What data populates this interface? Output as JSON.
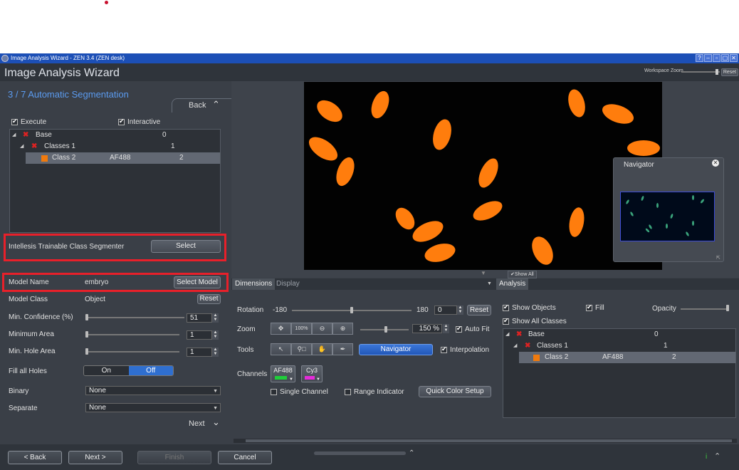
{
  "titlebar": {
    "text": "Image Analysis Wizard - ZEN 3.4 (ZEN desk)",
    "buttons": [
      "?",
      "–",
      "▫",
      "▢",
      "✕"
    ]
  },
  "header": {
    "title": "Image Analysis Wizard",
    "workspace_zoom_label": "Workspace Zoom",
    "reset_label": "Reset"
  },
  "wizard": {
    "step": "3 / 7 Automatic Segmentation",
    "back_label": "Back",
    "next_label": "Next",
    "execute_label": "Execute",
    "interactive_label": "Interactive",
    "tree": [
      {
        "name": "Base",
        "channel": "",
        "value": "0"
      },
      {
        "name": "Classes 1",
        "channel": "",
        "value": "1"
      },
      {
        "name": "Class 2",
        "channel": "AF488",
        "value": "2"
      }
    ],
    "segmenter_label": "Intellesis Trainable Class Segmenter",
    "select_label": "Select",
    "model_name_label": "Model Name",
    "model_name_value": "embryo",
    "select_model_label": "Select Model",
    "model_class_label": "Model Class",
    "model_class_value": "Object",
    "reset_label": "Reset",
    "min_confidence_label": "Min. Confidence (%)",
    "min_confidence_value": "51",
    "minimum_area_label": "Minimum Area",
    "minimum_area_value": "1",
    "min_hole_area_label": "Min. Hole Area",
    "min_hole_area_value": "1",
    "fill_all_holes_label": "Fill all Holes",
    "on_label": "On",
    "off_label": "Off",
    "binary_label": "Binary",
    "binary_value": "None",
    "separate_label": "Separate",
    "separate_value": "None"
  },
  "bottom": {
    "back": "< Back",
    "next": "Next >",
    "finish": "Finish",
    "cancel": "Cancel"
  },
  "navigator": {
    "title": "Navigator",
    "show_all": "Show All"
  },
  "tabs": {
    "dimensions": "Dimensions",
    "display": "Display",
    "analysis": "Analysis"
  },
  "dimensions": {
    "rotation_label": "Rotation",
    "rotation_min": "-180",
    "rotation_max": "180",
    "rotation_value": "0",
    "reset_label": "Reset",
    "zoom_label": "Zoom",
    "zoom_100": "100%",
    "zoom_value": "150 %",
    "auto_fit_label": "Auto Fit",
    "tools_label": "Tools",
    "navigator_label": "Navigator",
    "interpolation_label": "Interpolation",
    "channels_label": "Channels",
    "channel_1": "AF488",
    "channel_2": "Cy3",
    "channel_1_color": "#1fce3a",
    "channel_2_color": "#e52bd9",
    "single_channel_label": "Single Channel",
    "range_indicator_label": "Range Indicator",
    "quick_color_label": "Quick Color Setup"
  },
  "analysis": {
    "show_objects_label": "Show Objects",
    "fill_label": "Fill",
    "opacity_label": "Opacity",
    "show_all_classes_label": "Show All Classes",
    "tree": [
      {
        "name": "Base",
        "channel": "",
        "value": "0"
      },
      {
        "name": "Classes 1",
        "channel": "",
        "value": "1"
      },
      {
        "name": "Class 2",
        "channel": "AF488",
        "value": "2"
      }
    ]
  },
  "colors": {
    "accent": "#5b9bef",
    "highlight": "#e8202a",
    "object": "#ff7d0d",
    "navigator_button": "#2f6fd0"
  }
}
